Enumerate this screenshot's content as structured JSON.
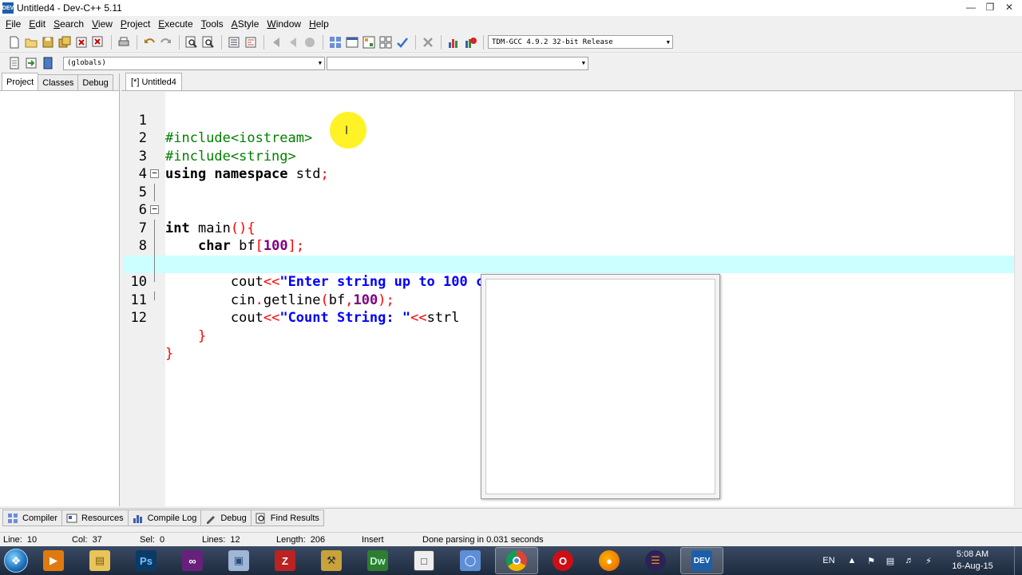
{
  "window": {
    "title": "Untitled4 - Dev-C++ 5.11",
    "app_icon": "DEV"
  },
  "menu": [
    "File",
    "Edit",
    "Search",
    "View",
    "Project",
    "Execute",
    "Tools",
    "AStyle",
    "Window",
    "Help"
  ],
  "toolbar": {
    "compiler_select": "TDM-GCC 4.9.2 32-bit Release",
    "scope_select": "(globals)",
    "member_select": ""
  },
  "left_panel": {
    "tabs": [
      "Project",
      "Classes",
      "Debug"
    ]
  },
  "editor": {
    "tab_label": "[*] Untitled4",
    "current_line": 10
  },
  "bottom_tabs": [
    "Compiler",
    "Resources",
    "Compile Log",
    "Debug",
    "Find Results"
  ],
  "status": {
    "line_label": "Line:",
    "line": "10",
    "col_label": "Col:",
    "col": "37",
    "sel_label": "Sel:",
    "sel": "0",
    "lines_label": "Lines:",
    "lines": "12",
    "length_label": "Length:",
    "length": "206",
    "mode": "Insert",
    "message": "Done parsing in 0.031 seconds"
  },
  "taskbar": {
    "language": "EN",
    "time": "5:08 AM",
    "date": "16-Aug-15",
    "apps": [
      "windows-media-player",
      "file-explorer",
      "photoshop",
      "visual-studio",
      "3d-box",
      "filezilla",
      "app-tools",
      "dreamweaver",
      "window-app",
      "network-app",
      "chrome",
      "opera",
      "firefox",
      "eclipse",
      "dev-cpp"
    ],
    "apps_labels": {
      "photoshop": "Ps",
      "dreamweaver": "Dw",
      "dev-cpp": "DEV"
    }
  },
  "colors": {
    "current_line_bg": "#ccffff",
    "preprocessor": "#008000",
    "string": "#0000ff",
    "number": "#800080",
    "symbol": "#ff0000"
  }
}
